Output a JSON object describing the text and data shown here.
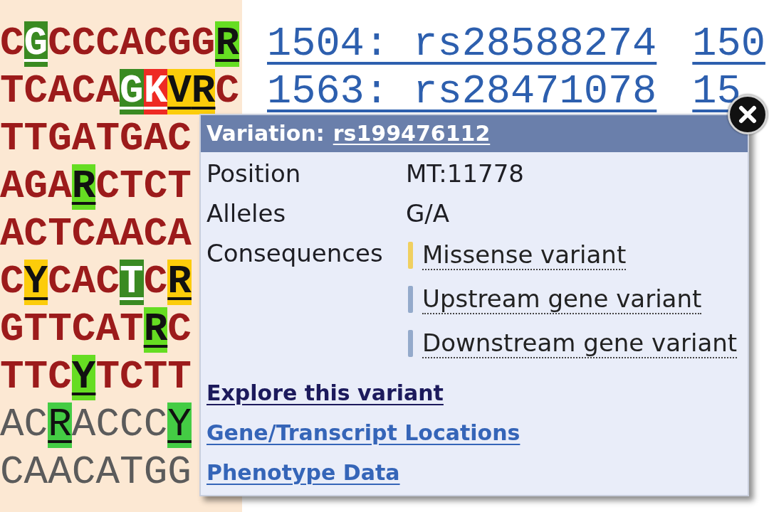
{
  "sequence": {
    "rows": [
      {
        "emphasized": true,
        "segments": [
          {
            "text": "C"
          },
          {
            "text": "G",
            "color": "#3a8a22"
          },
          {
            "text": "CCCACGG"
          },
          {
            "text": "R",
            "color": "#66dd22"
          }
        ]
      },
      {
        "emphasized": true,
        "segments": [
          {
            "text": "TCACA"
          },
          {
            "text": "G",
            "color": "#3a8a22"
          },
          {
            "text": "K",
            "color": "#ee2a24"
          },
          {
            "text": "V",
            "color": "#fccc0a"
          },
          {
            "text": "R",
            "color": "#fccc0a"
          },
          {
            "text": "C"
          }
        ]
      },
      {
        "emphasized": true,
        "segments": [
          {
            "text": "TTGATGAC"
          }
        ]
      },
      {
        "emphasized": true,
        "segments": [
          {
            "text": "AGA"
          },
          {
            "text": "R",
            "color": "#66dd22"
          },
          {
            "text": "CTCT"
          }
        ]
      },
      {
        "emphasized": true,
        "segments": [
          {
            "text": "ACTCAACA"
          }
        ]
      },
      {
        "emphasized": true,
        "segments": [
          {
            "text": "C"
          },
          {
            "text": "Y",
            "color": "#fccc0a"
          },
          {
            "text": "CAC"
          },
          {
            "text": "T",
            "color": "#3a8a22"
          },
          {
            "text": "C"
          },
          {
            "text": "R",
            "color": "#fccc0a"
          }
        ]
      },
      {
        "emphasized": true,
        "segments": [
          {
            "text": "GTTCAT"
          },
          {
            "text": "R",
            "color": "#66dd22"
          },
          {
            "text": "C"
          }
        ]
      },
      {
        "emphasized": true,
        "segments": [
          {
            "text": "TTC"
          },
          {
            "text": "Y",
            "color": "#66dd22"
          },
          {
            "text": "TCTT"
          }
        ]
      },
      {
        "emphasized": false,
        "segments": [
          {
            "text": "AC"
          },
          {
            "text": "R",
            "color": "#44cc44"
          },
          {
            "text": "ACCC"
          },
          {
            "text": "Y",
            "color": "#44cc44"
          }
        ]
      },
      {
        "emphasized": false,
        "segments": [
          {
            "text": "CAACATGG"
          }
        ]
      }
    ]
  },
  "variants": {
    "rows": [
      {
        "links": [
          "1504: rs28588274",
          "150"
        ]
      },
      {
        "links": [
          "1563: rs28471078",
          "15"
        ]
      }
    ]
  },
  "popup": {
    "title": "Variation:",
    "title_link": "rs199476112",
    "fields": [
      {
        "label": "Position",
        "value": "MT:11778"
      },
      {
        "label": "Alleles",
        "value": "G/A"
      }
    ],
    "consequences_label": "Consequences",
    "consequences": [
      {
        "text": "Missense variant",
        "color": "#f0d060"
      },
      {
        "text": "Upstream gene variant",
        "color": "#94aacb"
      },
      {
        "text": "Downstream gene variant",
        "color": "#94aacb"
      }
    ],
    "links": [
      {
        "text": "Explore this variant",
        "kind": "main"
      },
      {
        "text": "Gene/Transcript Locations",
        "kind": "related"
      },
      {
        "text": "Phenotype Data",
        "kind": "related"
      }
    ]
  }
}
